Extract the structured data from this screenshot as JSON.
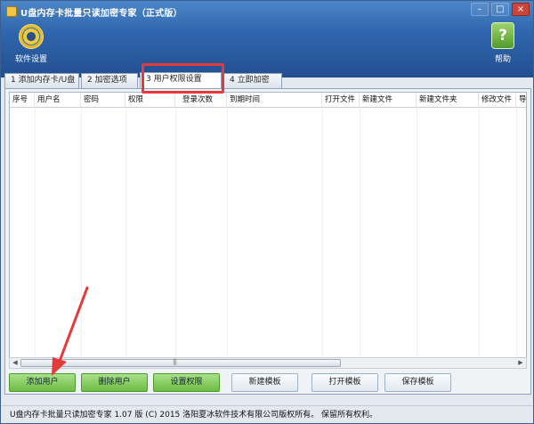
{
  "window": {
    "title": "U盘内存卡批量只读加密专家（正式版）",
    "accent": "#2f66ad",
    "annotation_color": "#e53a3a"
  },
  "toolbar": {
    "settings_label": "软件设置",
    "help_label": "帮助",
    "settings_icon": "gear-icon",
    "help_icon": "question-icon"
  },
  "tabs": [
    {
      "label": "1 添加内存卡/U盘"
    },
    {
      "label": "2 加密选项"
    },
    {
      "label": "3 用户权限设置",
      "active": true
    },
    {
      "label": "4 立即加密"
    }
  ],
  "table": {
    "columns": [
      "序号",
      "用户名",
      "密码",
      "权限",
      "登录次数",
      "到期时间",
      "打开文件",
      "新建文件",
      "新建文件夹",
      "修改文件",
      "导"
    ],
    "rows": []
  },
  "buttons": {
    "add_user": "添加用户",
    "delete_user": "删除用户",
    "set_permission": "设置权限",
    "new_template": "新建模板",
    "open_template": "打开模板",
    "save_template": "保存模板"
  },
  "status": {
    "text": "U盘内存卡批量只读加密专家 1.07 版  (C)  2015  洛阳夏冰软件技术有限公司版权所有。 保留所有权利。"
  },
  "window_buttons": {
    "minimize": "–",
    "maximize": "□",
    "close": "×"
  },
  "scrollbar": {
    "left_arrow": "◀",
    "right_arrow": "▶"
  }
}
